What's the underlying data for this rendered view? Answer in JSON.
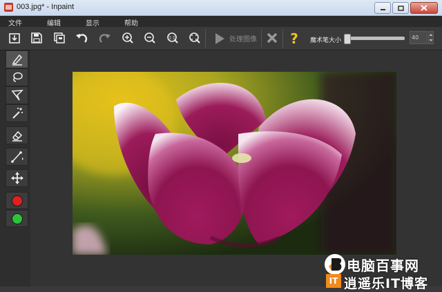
{
  "window": {
    "title": "003.jpg* - Inpaint"
  },
  "menu": {
    "items": [
      "文件",
      "编辑",
      "显示",
      "帮助"
    ]
  },
  "toolbar": {
    "process_label": "处理图像",
    "brush_size_label": "魔术笔大小",
    "brush_size_value": "40",
    "brush_size_level": 0.0
  },
  "tools": [
    "marker-icon",
    "lasso-icon",
    "polygon-lasso-icon",
    "magic-wand-icon",
    "eraser-icon",
    "line-icon",
    "move-icon"
  ],
  "colors": {
    "red": "#e02020",
    "green": "#2ec23a",
    "accent_yellow": "#f2c31c"
  },
  "watermark": {
    "line1": "电脑百事网",
    "line2": "逍遥乐IT博客",
    "badge": "IT"
  }
}
